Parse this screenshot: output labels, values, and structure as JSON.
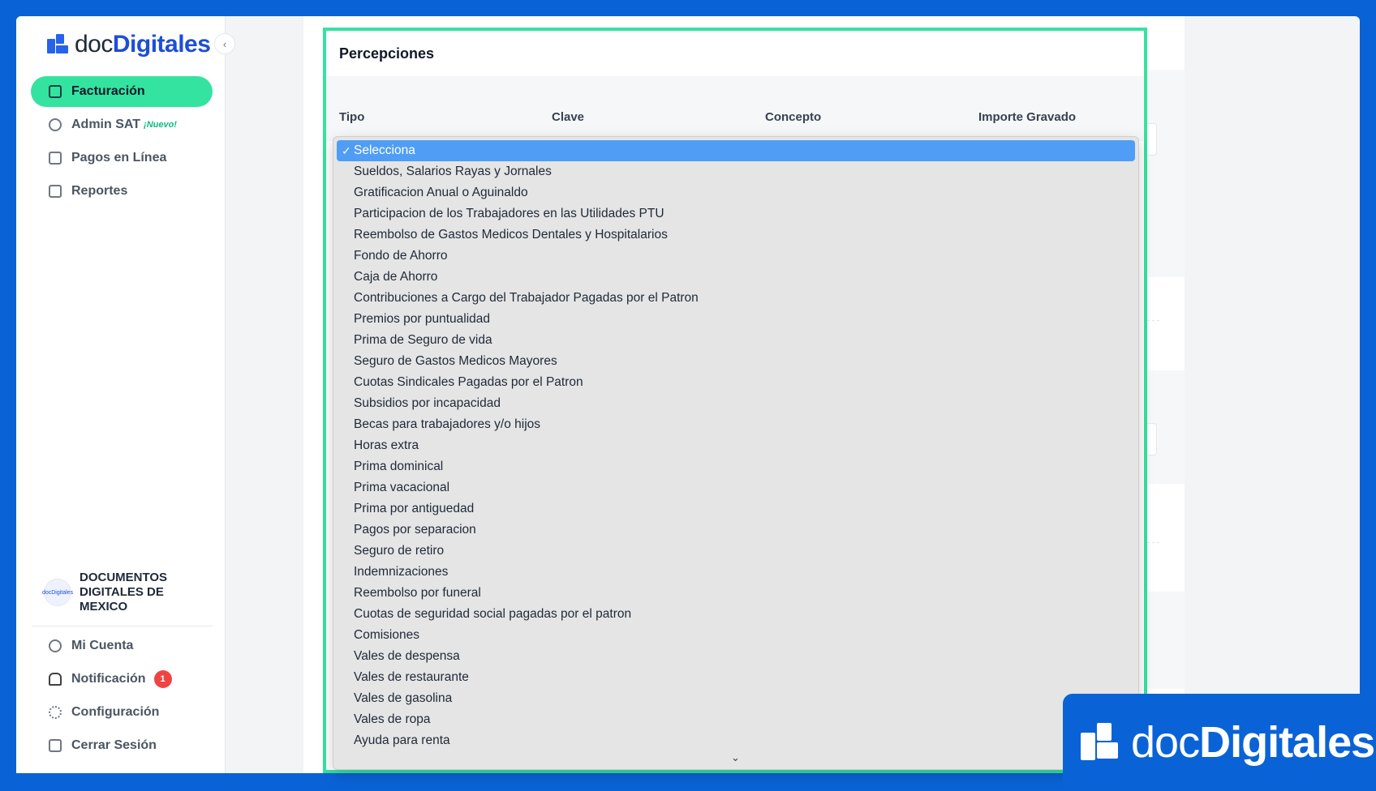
{
  "brand": {
    "name_part1": "doc",
    "name_part2": "Digitales"
  },
  "sidebar": {
    "items": [
      {
        "label": "Facturación",
        "active": true
      },
      {
        "label": "Admin SAT",
        "tag": "¡Nuevo!"
      },
      {
        "label": "Pagos en Línea"
      },
      {
        "label": "Reportes"
      }
    ],
    "org_name": "DOCUMENTOS DIGITALES DE MEXICO",
    "org_avatar_text": "docDigitales",
    "bottom": [
      {
        "label": "Mi Cuenta"
      },
      {
        "label": "Notificación",
        "badge": "1"
      },
      {
        "label": "Configuración"
      },
      {
        "label": "Cerrar Sesión"
      }
    ]
  },
  "form": {
    "section_title": "Percepciones",
    "columns": [
      "Tipo",
      "Clave",
      "Concepto",
      "Importe Gravado"
    ]
  },
  "dropdown": {
    "selected": "Selecciona",
    "options": [
      "Sueldos, Salarios Rayas y Jornales",
      "Gratificacion Anual o Aguinaldo",
      "Participacion de los Trabajadores en las Utilidades PTU",
      "Reembolso de Gastos Medicos Dentales y Hospitalarios",
      "Fondo de Ahorro",
      "Caja de Ahorro",
      "Contribuciones a Cargo del Trabajador Pagadas por el Patron",
      "Premios por puntualidad",
      "Prima de Seguro de vida",
      "Seguro de Gastos Medicos Mayores",
      "Cuotas Sindicales Pagadas por el Patron",
      "Subsidios por incapacidad",
      "Becas para trabajadores y/o hijos",
      "Horas extra",
      "Prima dominical",
      "Prima vacacional",
      "Prima por antiguedad",
      "Pagos por separacion",
      "Seguro de retiro",
      "Indemnizaciones",
      "Reembolso por funeral",
      "Cuotas de seguridad social pagadas por el patron",
      "Comisiones",
      "Vales de despensa",
      "Vales de restaurante",
      "Vales de gasolina",
      "Vales de ropa",
      "Ayuda para renta"
    ]
  },
  "watermark": {
    "part1": "doc",
    "part2": "Digitales"
  },
  "colors": {
    "accent": "#34e3a0",
    "frame": "#0a63d6",
    "selected": "#4f9df5"
  }
}
